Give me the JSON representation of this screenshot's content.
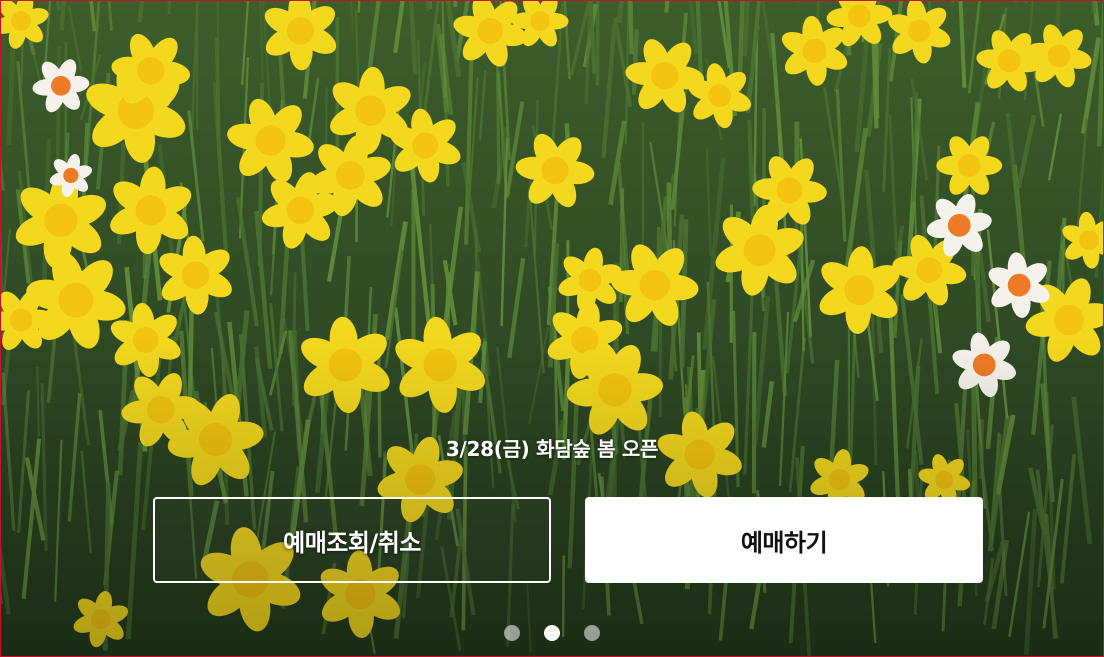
{
  "hero": {
    "caption": "3/28(금) 화담숲 봄 오픈",
    "slide_count": 3,
    "active_slide": 2
  },
  "buttons": {
    "lookup_cancel_label": "예매조회/취소",
    "book_label": "예매하기"
  },
  "colors": {
    "grass_dark": "#2f4a24",
    "grass_light": "#5f8a3a",
    "daffodil_yellow": "#f3d81e",
    "daffodil_center": "#f2c40f",
    "white_petal": "#f4f2ea",
    "orange_center": "#ef7a25",
    "frame_border": "#c8102e"
  }
}
